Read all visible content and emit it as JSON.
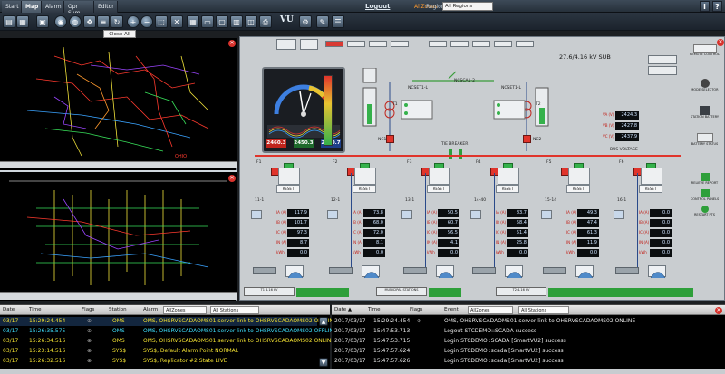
{
  "topbar": {
    "tabs": [
      "Start",
      "Map",
      "Alarm",
      "Opr Sum",
      "Editor"
    ],
    "logout": "Logout",
    "allzones": "AllZones",
    "region_label": "Region",
    "region_value": "All Regions",
    "help_icons": [
      "i",
      "?"
    ]
  },
  "toolbar": {
    "vu_label": "VU",
    "close_all": "Close All"
  },
  "map": {
    "label_top": "OHIO"
  },
  "diagram": {
    "subtitle": "27.6/4.16 kV SUB",
    "gauge_values": [
      "2460.3",
      "2450.3",
      "2460.7"
    ],
    "transformers": [
      "T1",
      "T2"
    ],
    "switches": [
      "NCSET1-L",
      "NCSCA1-2",
      "NCSET1-L"
    ],
    "breakers_main": [
      "NC1",
      "NC2"
    ],
    "tie_breaker": "TIE BREAKER",
    "bus_voltage_label": "BUS VOLTAGE",
    "bus_voltage": [
      {
        "label": "VA (V)",
        "value": "2424.3"
      },
      {
        "label": "VB (V)",
        "value": "2427.8"
      },
      {
        "label": "VC (V)",
        "value": "2437.9"
      }
    ],
    "reset_label": "RESET",
    "feeders": [
      {
        "name": "F1",
        "id": "11-1",
        "ia": "117.9",
        "ib": "101.7",
        "ic": "97.3",
        "in": "8.7",
        "kw": "0.0"
      },
      {
        "name": "F2",
        "id": "12-1",
        "ia": "73.8",
        "ib": "68.0",
        "ic": "72.0",
        "in": "8.1",
        "kw": "0.0"
      },
      {
        "name": "F3",
        "id": "13-1",
        "ia": "50.5",
        "ib": "60.7",
        "ic": "56.5",
        "in": "4.1",
        "kw": "0.0"
      },
      {
        "name": "F4",
        "id": "14-40",
        "ia": "83.7",
        "ib": "58.4",
        "ic": "51.4",
        "in": "25.8",
        "kw": "0.0"
      },
      {
        "name": "F5",
        "id": "15-14",
        "ia": "49.3",
        "ib": "47.4",
        "ic": "61.3",
        "in": "11.9",
        "kw": "0.0"
      },
      {
        "name": "F6",
        "id": "16-1",
        "ia": "0.0",
        "ib": "0.0",
        "ic": "0.0",
        "in": "0.0",
        "kw": "0.0"
      }
    ],
    "meter_labels": [
      "IA (A)",
      "IB (A)",
      "IC (A)",
      "IN (A)",
      "kWh"
    ],
    "footer_labels": [
      "T1 4.16 kV",
      "MUNICIPAL STATIONS",
      "T2 4.16 kV"
    ],
    "side_buttons": [
      "REMOTE CONTROL",
      "MODE SELECTOR",
      "STATION BATTERY",
      "BATTERY STATUS",
      "RELIEVE REPORT",
      "CONTROL PANELS",
      "RESTART PTS"
    ]
  },
  "alarm": {
    "headers": {
      "date": "Date",
      "time": "Time",
      "flags": "Flags",
      "station": "Station",
      "alarm": "Alarm",
      "filter1": "AllZones",
      "filter2": "All Stations"
    },
    "rows": [
      {
        "date": "03/17",
        "time": "15:29:24.454",
        "flags": "⊕",
        "station": "OMS",
        "alarm": "OMS, OHSRVSCADAOMS01 server link to OHSRVSCADAOMS02 OFFLINE",
        "color": "#f4e232"
      },
      {
        "date": "03/17",
        "time": "15:26:35.575",
        "flags": "⊕",
        "station": "OMS",
        "alarm": "OMS, OHSRVSCADAOMS01 server link to OHSRVSCADAOMS02 OFFLINE",
        "color": "#3ee0ff"
      },
      {
        "date": "03/17",
        "time": "15:26:34.516",
        "flags": "⊕",
        "station": "OMS",
        "alarm": "OMS, OHSRVSCADAOMS01 server link to OHSRVSCADAOMS02 ONLINE",
        "color": "#f4e232"
      },
      {
        "date": "03/17",
        "time": "15:23:14.516",
        "flags": "⊕",
        "station": "SYS$",
        "alarm": "SYS$, Default Alarm Point NORMAL",
        "color": "#f4e232"
      },
      {
        "date": "03/17",
        "time": "15:26:32.516",
        "flags": "⊕",
        "station": "SYS$",
        "alarm": "SYS$, Replicator #2 State LIVE",
        "color": "#f4e232"
      }
    ]
  },
  "event": {
    "headers": {
      "date": "Date ▲",
      "time": "Time",
      "flags": "Flags",
      "event": "Event",
      "filter1": "AllZones",
      "filter2": "All Stations"
    },
    "rows": [
      {
        "date": "2017/03/17",
        "time": "15:29:24.454",
        "flags": "⊕",
        "event": "OMS, OHSRVSCADAOMS01 server link to OHSRVSCADAOMS02 ONLINE"
      },
      {
        "date": "2017/03/17",
        "time": "15:47:53.713",
        "flags": "",
        "event": "Logout STCDEMO::SCADA success"
      },
      {
        "date": "2017/03/17",
        "time": "15:47:53.715",
        "flags": "",
        "event": "Login STCDEMO::SCADA [SmartVU2] success"
      },
      {
        "date": "2017/03/17",
        "time": "15:47:57.624",
        "flags": "",
        "event": "Login STCDEMO::scada [SmartVU2] success"
      },
      {
        "date": "2017/03/17",
        "time": "15:47:57.626",
        "flags": "",
        "event": "Login STCDEMO::scada [SmartVU2] success"
      }
    ]
  }
}
